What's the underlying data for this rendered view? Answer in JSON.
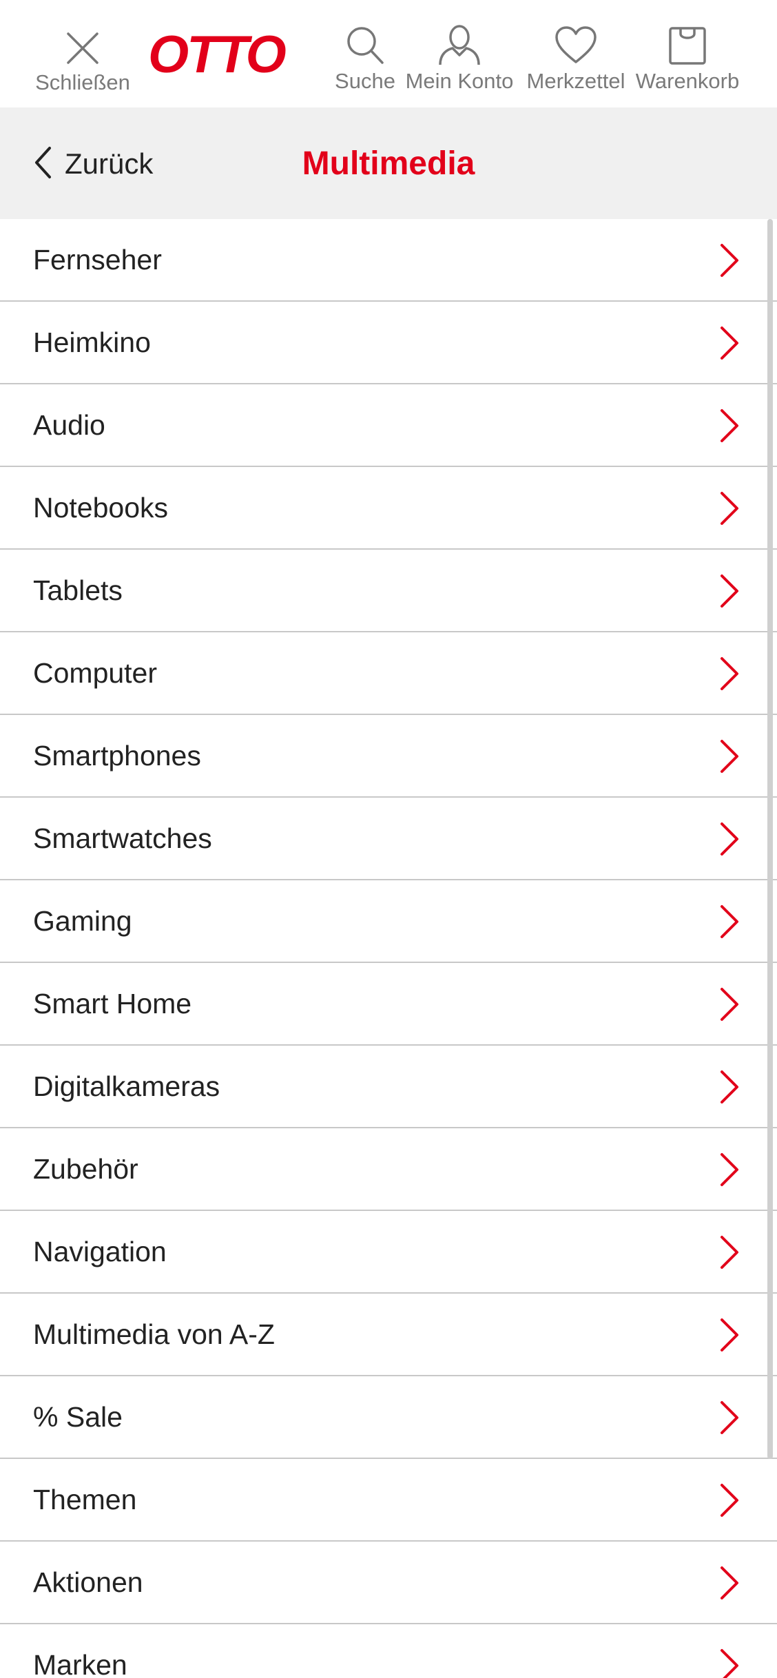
{
  "topbar": {
    "close_label": "Schließen",
    "logo_text": "OTTO",
    "search_label": "Suche",
    "account_label": "Mein Konto",
    "wishlist_label": "Merkzettel",
    "cart_label": "Warenkorb"
  },
  "category": {
    "back_label": "Zurück",
    "title": "Multimedia"
  },
  "items": [
    {
      "label": "Fernseher"
    },
    {
      "label": "Heimkino"
    },
    {
      "label": "Audio"
    },
    {
      "label": "Notebooks"
    },
    {
      "label": "Tablets"
    },
    {
      "label": "Computer"
    },
    {
      "label": "Smartphones"
    },
    {
      "label": "Smartwatches"
    },
    {
      "label": "Gaming"
    },
    {
      "label": "Smart Home"
    },
    {
      "label": "Digitalkameras"
    },
    {
      "label": "Zubehör"
    },
    {
      "label": "Navigation"
    },
    {
      "label": "Multimedia von A-Z"
    },
    {
      "label": "% Sale"
    },
    {
      "label": "Themen"
    },
    {
      "label": "Aktionen"
    },
    {
      "label": "Marken"
    }
  ],
  "colors": {
    "brand": "#e2001a",
    "header_bg": "#f0f0f0",
    "divider": "#c8c8c8",
    "icon_gray": "#777777"
  }
}
